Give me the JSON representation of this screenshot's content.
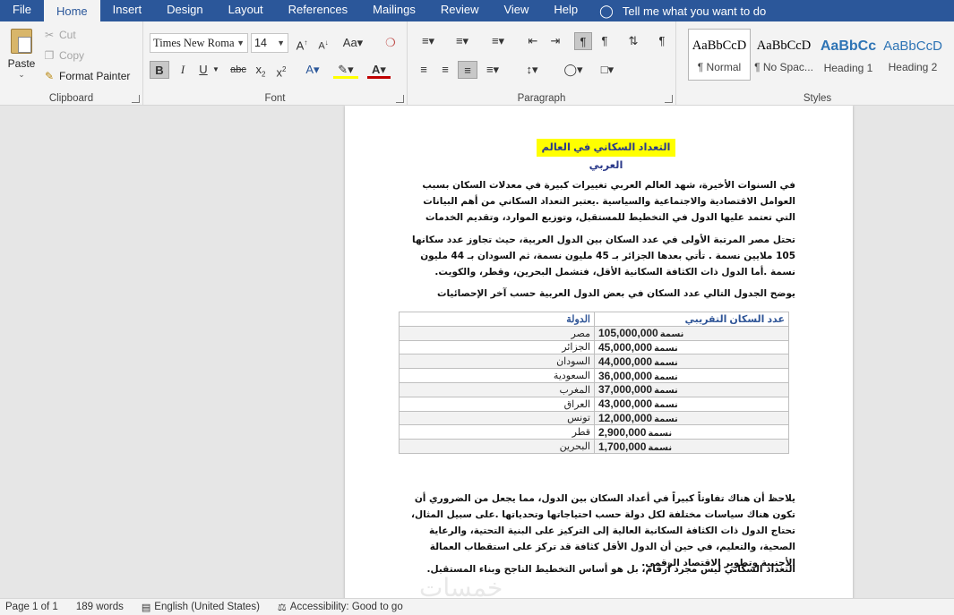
{
  "menu": {
    "tabs": [
      "File",
      "Home",
      "Insert",
      "Design",
      "Layout",
      "References",
      "Mailings",
      "Review",
      "View",
      "Help"
    ],
    "active": "Home",
    "tell_me": "Tell me what you want to do"
  },
  "ribbon": {
    "clipboard": {
      "paste": "Paste",
      "cut": "Cut",
      "copy": "Copy",
      "format_painter": "Format Painter",
      "label": "Clipboard"
    },
    "font": {
      "name": "Times New Roma",
      "size": "14",
      "label": "Font"
    },
    "paragraph": {
      "label": "Paragraph"
    },
    "styles": {
      "label": "Styles",
      "items": [
        {
          "sample": "AaBbCcD",
          "name": "¶ Normal"
        },
        {
          "sample": "AaBbCcD",
          "name": "¶ No Spac..."
        },
        {
          "sample": "AaBbCc",
          "name": "Heading 1"
        },
        {
          "sample": "AaBbCcD",
          "name": "Heading 2"
        }
      ]
    }
  },
  "document": {
    "title": "التعداد السكاني في العالم العربي",
    "p1": "في السنوات الأخيرة، شهد العالم العربي تغييرات كبيرة في معدلات السكان بسبب العوامل الاقتصادية والاجتماعية والسياسية .يعتبر التعداد السكاني من أهم البيانات التي تعتمد عليها الدول في التخطيط للمستقبل، وتوزيع الموارد، وتقديم الخدمات",
    "p2": "تحتل مصر المرتبة الأولى في عدد السكان بين الدول العربية، حيث تجاوز عدد سكانها 105 ملايين نسمة . تأتي بعدها الجزائر بـ 45 مليون نسمة، ثم السودان بـ 44 مليون نسمة .أما الدول ذات الكثافة السكانية الأقل، فتشمل البحرين، وقطر، والكويت.",
    "p3": "يوضح الجدول التالي عدد السكان في بعض الدول العربية حسب آخر الإحصائيات",
    "table": {
      "header_country": "الدولة",
      "header_population": "عدد السكان التقريبي",
      "unit": "نسمة",
      "rows": [
        {
          "country": "مصر",
          "population": "105,000,000"
        },
        {
          "country": "الجزائر",
          "population": "45,000,000"
        },
        {
          "country": "السودان",
          "population": "44,000,000"
        },
        {
          "country": "السعودية",
          "population": "36,000,000"
        },
        {
          "country": "المغرب",
          "population": "37,000,000"
        },
        {
          "country": "العراق",
          "population": "43,000,000"
        },
        {
          "country": "تونس",
          "population": "12,000,000"
        },
        {
          "country": "قطر",
          "population": "2,900,000"
        },
        {
          "country": "البحرين",
          "population": "1,700,000"
        }
      ]
    },
    "p4": "يلاحظ أن هناك تفاوتاً كبيراً في أعداد السكان بين الدول، مما يجعل من الضروري أن تكون هناك سياسات مختلفة لكل دولة حسب احتياجاتها وتحدياتها .على سبيل المثال، تحتاج الدول ذات الكثافة السكانية العالية إلى التركيز على البنية التحتية، والرعاية الصحية، والتعليم، في حين أن الدول الأقل كثافة قد تركز على استقطاب العمالة الأجنبية وتطوير الاقتصاد الرقمي.",
    "p5": "التعداد السكاني ليس مجرد أرقام، بل هو أساس التخطيط الناجح وبناء المستقبل."
  },
  "status": {
    "page": "Page 1 of 1",
    "words": "189 words",
    "language": "English (United States)",
    "accessibility": "Accessibility: Good to go"
  },
  "watermark": "خمسات"
}
